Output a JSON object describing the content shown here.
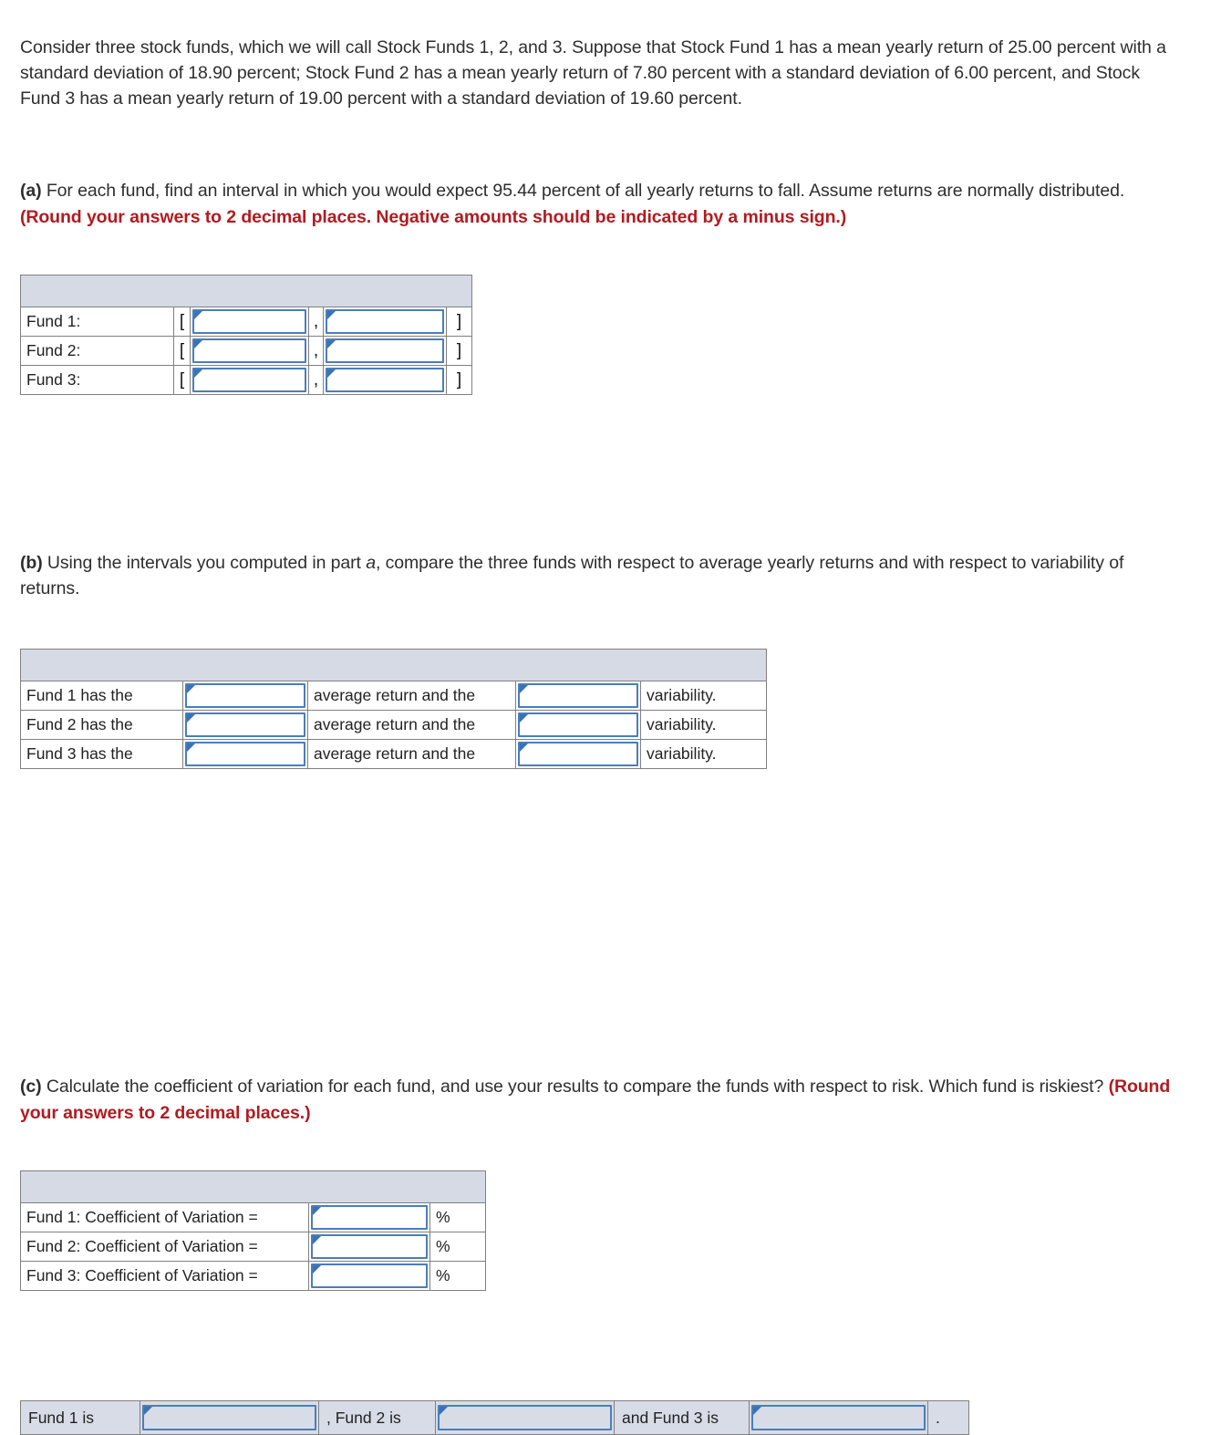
{
  "intro": {
    "paragraph": "Consider three stock funds, which we will call Stock Funds 1, 2, and 3. Suppose that Stock Fund 1 has a mean yearly return of 25.00 percent with a standard deviation of 18.90 percent; Stock Fund 2 has a mean yearly return of 7.80 percent with a standard deviation of 6.00 percent, and Stock Fund 3 has a mean yearly return of 19.00 percent with a standard deviation of 19.60 percent."
  },
  "part_a": {
    "label": "(a)",
    "text": " For each fund, find an interval in which you would expect 95.44 percent of all yearly returns to fall. Assume returns are normally distributed. ",
    "instruction": "(Round your answers to 2 decimal places. Negative amounts should be indicated by a minus sign.)",
    "table": {
      "rows": [
        {
          "label": "Fund 1:",
          "open_bracket": "[",
          "separator": ",",
          "close_bracket": "]",
          "lower_value": "",
          "upper_value": ""
        },
        {
          "label": "Fund 2:",
          "open_bracket": "[",
          "separator": ",",
          "close_bracket": "]",
          "lower_value": "",
          "upper_value": ""
        },
        {
          "label": "Fund 3:",
          "open_bracket": "[",
          "separator": ",",
          "close_bracket": "]",
          "lower_value": "",
          "upper_value": ""
        }
      ]
    }
  },
  "part_b": {
    "label": "(b)",
    "text_before_italic": " Using the intervals you computed in part ",
    "italic_word": "a",
    "text_after_italic": ", compare the three funds with respect to average yearly returns and with respect to variability of returns.",
    "table": {
      "rows": [
        {
          "prefix": "Fund 1 has the",
          "middle": "average return and the",
          "suffix": "variability.",
          "return_value": "",
          "variability_value": ""
        },
        {
          "prefix": "Fund 2 has the",
          "middle": "average return and the",
          "suffix": "variability.",
          "return_value": "",
          "variability_value": ""
        },
        {
          "prefix": "Fund 3 has the",
          "middle": "average return and the",
          "suffix": "variability.",
          "return_value": "",
          "variability_value": ""
        }
      ]
    }
  },
  "part_c": {
    "label": "(c)",
    "text": " Calculate the coefficient of variation for each fund, and use your results to compare the funds with respect to risk. Which fund is riskiest? ",
    "instruction": "(Round your answers to 2 decimal places.)",
    "table": {
      "rows": [
        {
          "label": "Fund 1: Coefficient of Variation =",
          "unit": "%",
          "value": ""
        },
        {
          "label": "Fund 2: Coefficient of Variation =",
          "unit": "%",
          "value": ""
        },
        {
          "label": "Fund 3: Coefficient of Variation =",
          "unit": "%",
          "value": ""
        }
      ]
    },
    "summary_strip": {
      "segment_1_label": "Fund 1 is",
      "segment_1_value": "",
      "segment_2_label": ", Fund 2 is",
      "segment_2_value": "",
      "segment_3_label": "and Fund 3 is",
      "segment_3_value": "",
      "terminator": "."
    }
  },
  "colors": {
    "header_fill": "#d5dae5",
    "input_border": "#4a7ebb",
    "input_flag": "#3a72b4",
    "instruction_red": "#b01c21",
    "grid_line": "#808080",
    "strip_fill": "#d8dce7"
  }
}
